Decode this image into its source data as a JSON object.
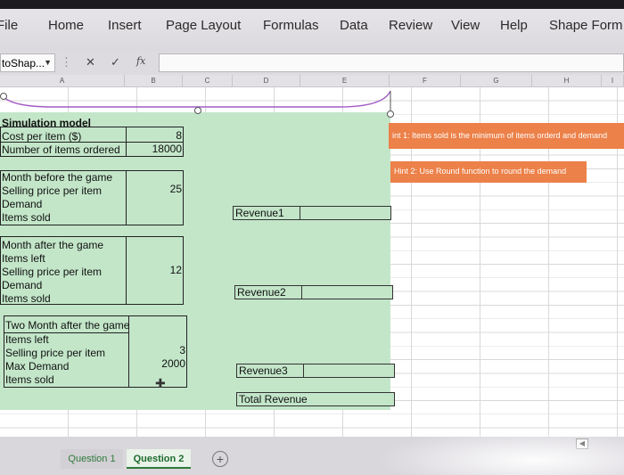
{
  "ribbon": {
    "tabs": [
      {
        "label": "File"
      },
      {
        "label": "Home"
      },
      {
        "label": "Insert"
      },
      {
        "label": "Page Layout"
      },
      {
        "label": "Formulas"
      },
      {
        "label": "Data"
      },
      {
        "label": "Review"
      },
      {
        "label": "View"
      },
      {
        "label": "Help"
      },
      {
        "label": "Shape Form"
      }
    ]
  },
  "formula_bar": {
    "name_box": "toShap...",
    "fx_label": "fx",
    "cancel_glyph": "✕",
    "enter_glyph": "✓",
    "value": ""
  },
  "columns": [
    "A",
    "B",
    "C",
    "D",
    "E",
    "F",
    "G",
    "H",
    "I"
  ],
  "model": {
    "title": "Simulation model",
    "cost_label": "Cost per item ($)",
    "cost_value": "8",
    "ordered_label": "Number of items ordered",
    "ordered_value": "18000",
    "before": {
      "heading": "Month before the game",
      "price_label": "Selling price per item",
      "price_value": "25",
      "demand_label": "Demand",
      "sold_label": "Items sold"
    },
    "after": {
      "heading": "Month after the game",
      "left_label": "Items left",
      "price_label": "Selling price per item",
      "price_value": "12",
      "demand_label": "Demand",
      "sold_label": "Items sold"
    },
    "two_after": {
      "heading": "Two Month after the game",
      "left_label": "Items left",
      "price_label": "Selling price per item",
      "price_value": "3",
      "max_label": "Max Demand",
      "max_value": "2000",
      "sold_label": "Items sold"
    },
    "revenue1": "Revenue1",
    "revenue2": "Revenue2",
    "revenue3": "Revenue3",
    "total_revenue": "Total Revenue"
  },
  "hints": {
    "hint1": "int 1: Items sold is the minimum of items orderd and demand",
    "hint2": "Hint 2: Use Round function to round the demand"
  },
  "sheet_tabs": {
    "tab1": "Question 1",
    "tab2": "Question 2",
    "add": "+"
  },
  "colors": {
    "green_fill": "#c3e6c9",
    "hint_fill": "#ec8149",
    "shape_outline": "#a35bc6"
  }
}
